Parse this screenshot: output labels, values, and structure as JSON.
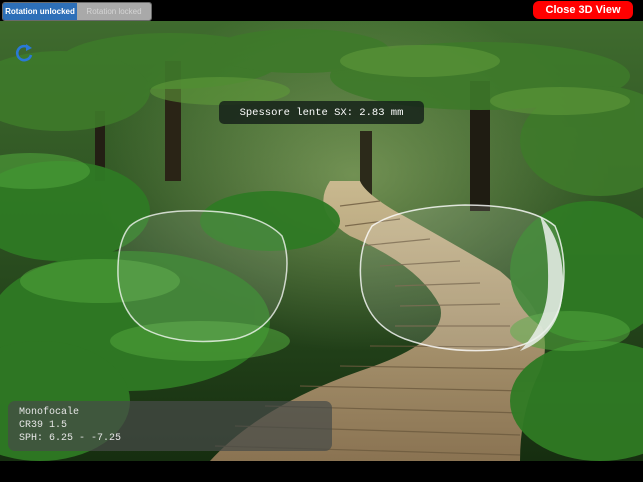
{
  "toolbar": {
    "rotation_locked_option": "Rotation unlocked",
    "rotation_alt_option": "Rotation locked",
    "close_label": "Close 3D View"
  },
  "scene": {
    "rotate_icon": "rotate-icon",
    "thickness_text": "Spessore lente SX: 2.83 mm"
  },
  "info": {
    "lens_type": "Monofocale",
    "material": "CR39 1.5",
    "sph": "SPH: 6.25 - -7.25"
  },
  "colors": {
    "segment_active": "#2d6fb8",
    "close_button": "#ff0000",
    "rotate_icon": "#2a79d6"
  }
}
